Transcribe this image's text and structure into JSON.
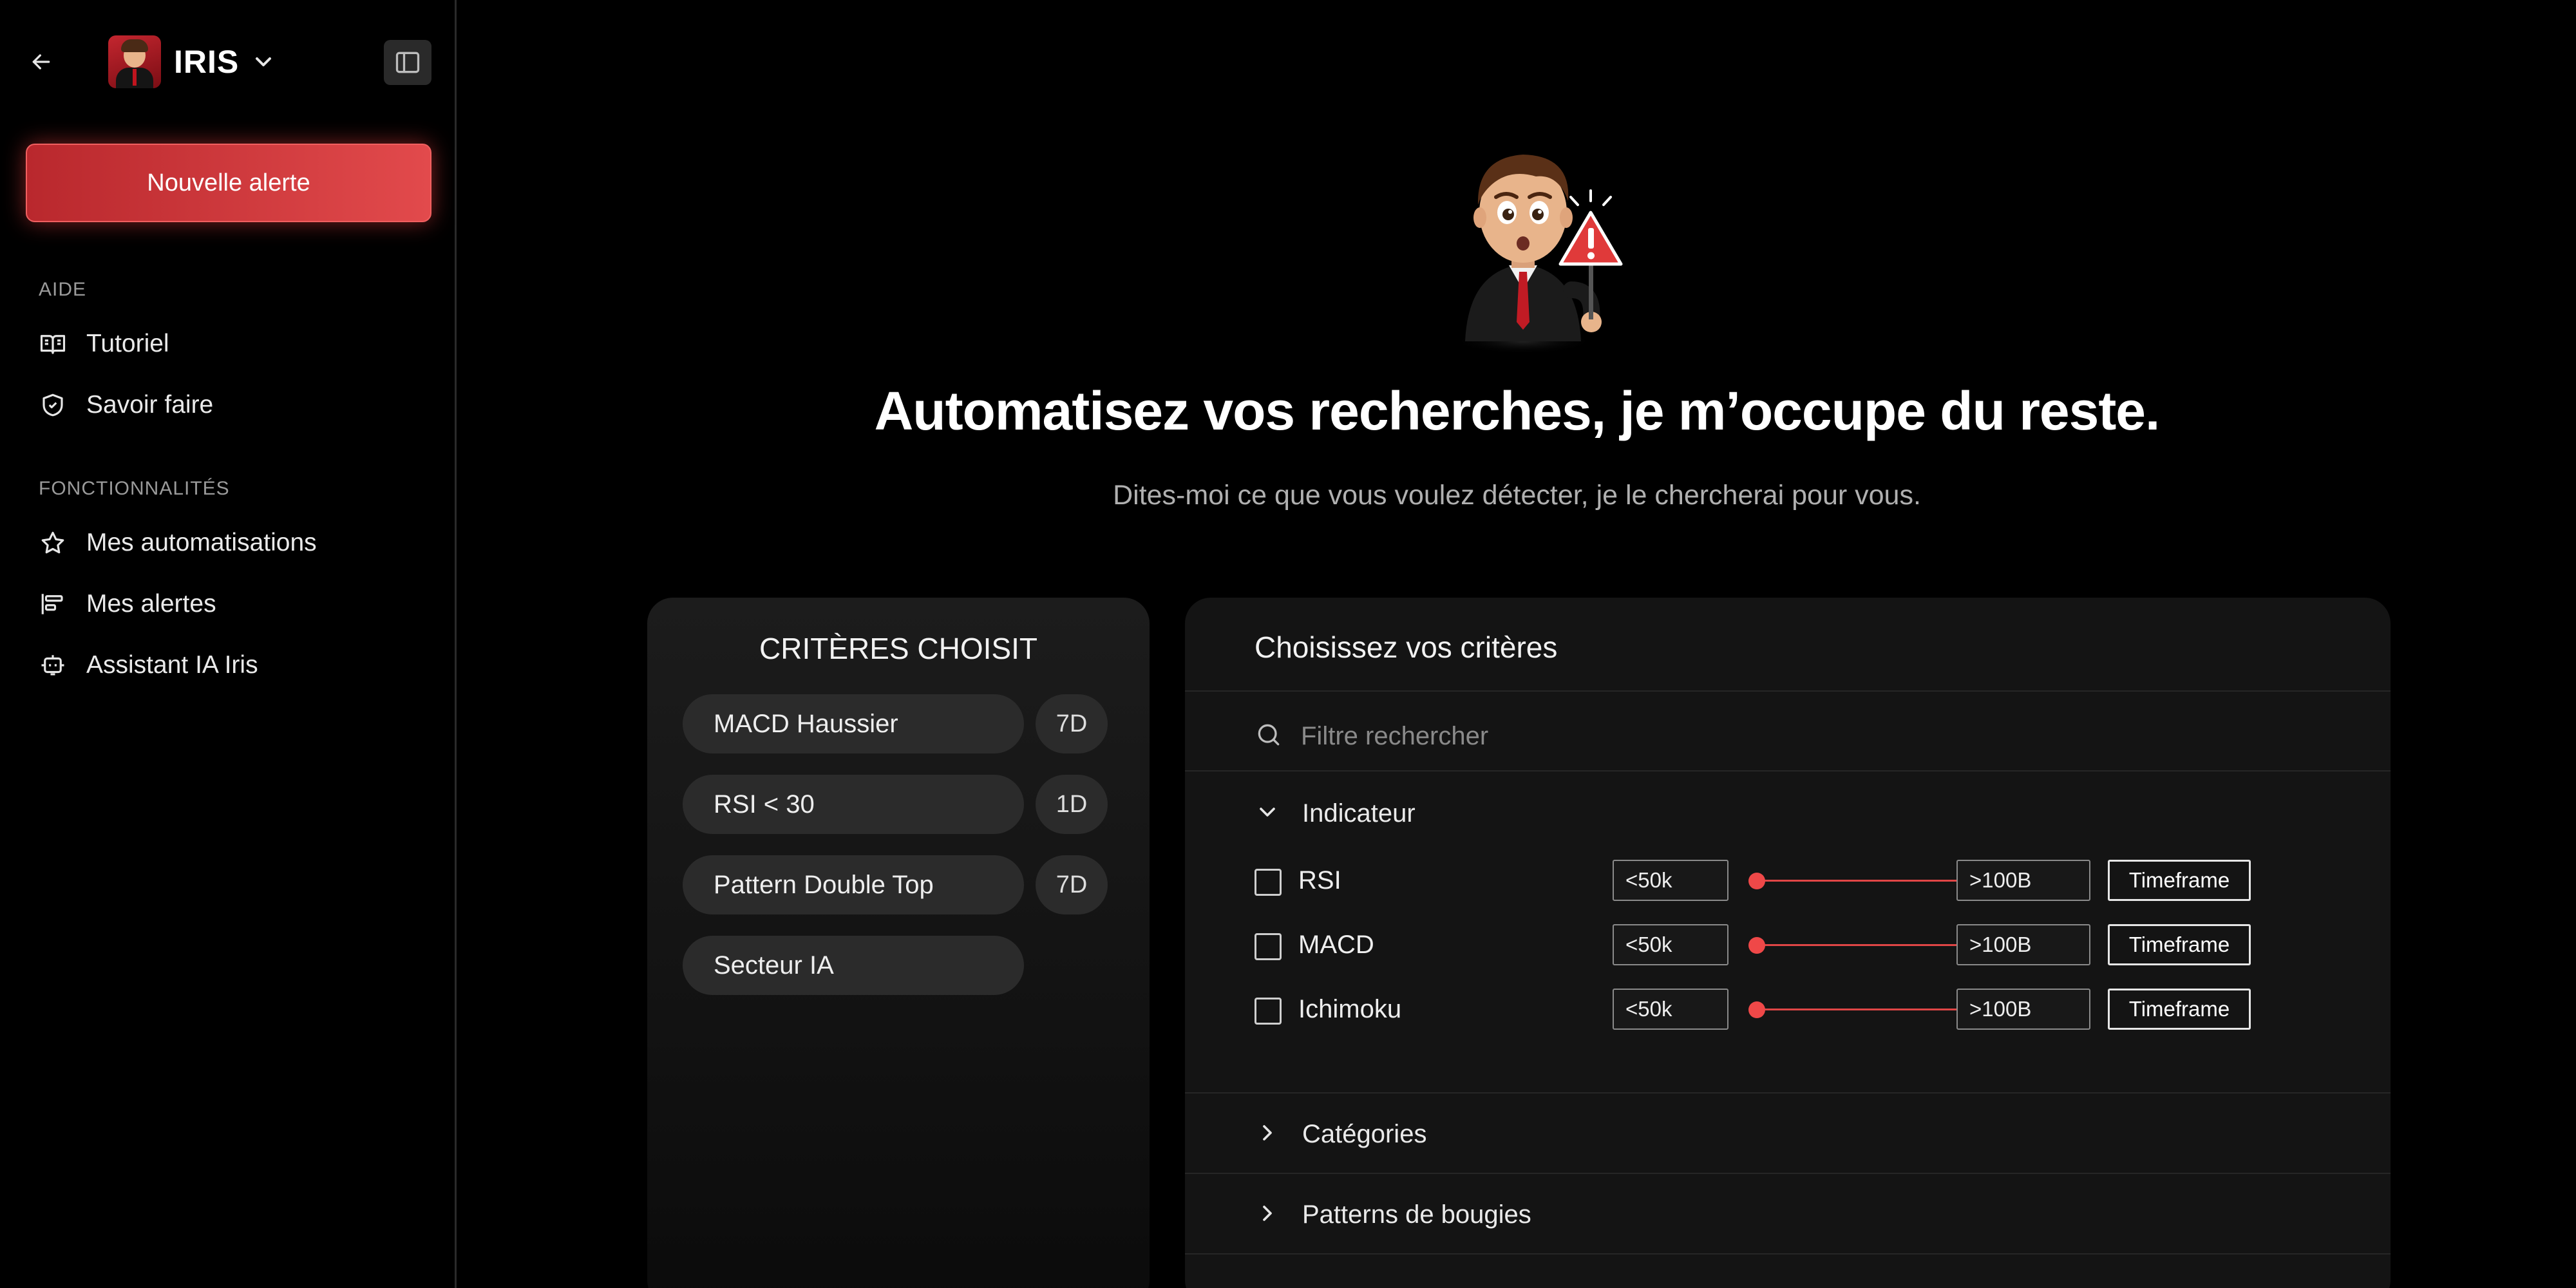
{
  "app": {
    "name": "IRIS"
  },
  "sidebar": {
    "new_alert_label": "Nouvelle alerte",
    "sections": [
      {
        "label": "AIDE",
        "items": [
          {
            "label": "Tutoriel",
            "icon": "book-icon"
          },
          {
            "label": "Savoir faire",
            "icon": "shield-icon"
          }
        ]
      },
      {
        "label": "FONCTIONNALITÉS",
        "items": [
          {
            "label": "Mes automatisations",
            "icon": "star-icon"
          },
          {
            "label": "Mes alertes",
            "icon": "bars-icon"
          },
          {
            "label": "Assistant IA Iris",
            "icon": "bot-icon"
          }
        ]
      }
    ]
  },
  "hero": {
    "headline": "Automatisez vos recherches, je m’occupe du reste.",
    "subline": "Dites-moi ce que vous voulez détecter, je le chercherai pour vous."
  },
  "selected_criteria": {
    "title": "CRITÈRES CHOISIT",
    "items": [
      {
        "label": "MACD Haussier",
        "timeframe": "7D"
      },
      {
        "label": "RSI < 30",
        "timeframe": "1D"
      },
      {
        "label": "Pattern Double Top",
        "timeframe": "7D"
      },
      {
        "label": "Secteur IA",
        "timeframe": ""
      }
    ]
  },
  "criteria_picker": {
    "title": "Choisissez vos critères",
    "search_placeholder": "Filtre rechercher",
    "sections": [
      {
        "label": "Indicateur",
        "expanded": true
      },
      {
        "label": "Catégories",
        "expanded": false
      },
      {
        "label": "Patterns de bougies",
        "expanded": false
      }
    ],
    "indicators": [
      {
        "label": "RSI",
        "checked": false,
        "min": "<50k",
        "max": ">100B",
        "timeframe_label": "Timeframe"
      },
      {
        "label": "MACD",
        "checked": false,
        "min": "<50k",
        "max": ">100B",
        "timeframe_label": "Timeframe"
      },
      {
        "label": "Ichimoku",
        "checked": false,
        "min": "<50k",
        "max": ">100B",
        "timeframe_label": "Timeframe"
      }
    ]
  },
  "colors": {
    "accent": "#e24a4c",
    "background": "#000000",
    "card": "#141414"
  }
}
